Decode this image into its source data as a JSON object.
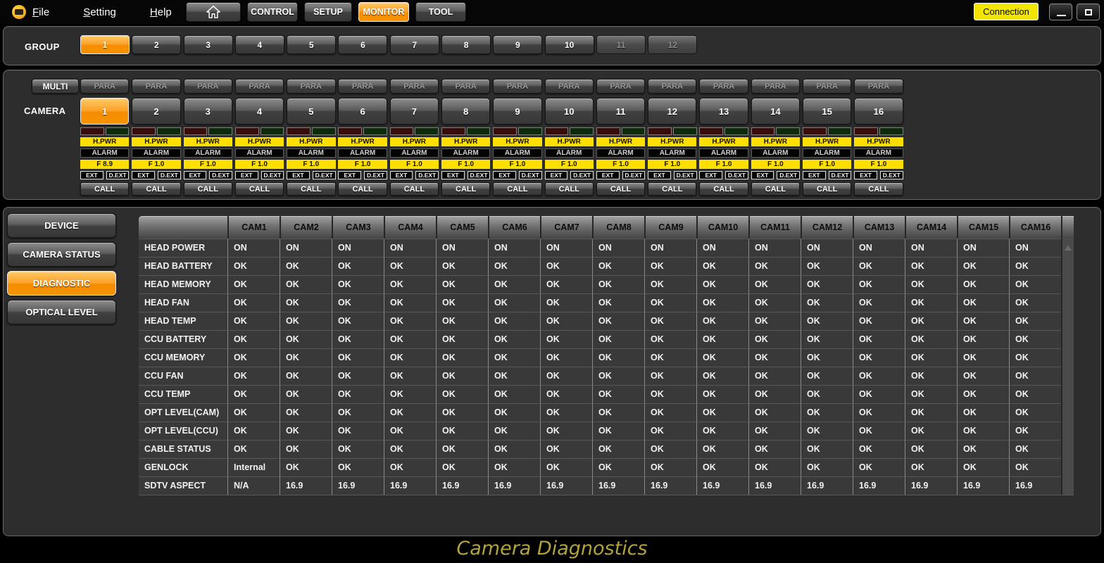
{
  "titlebar": {
    "menus": [
      {
        "label": "File"
      },
      {
        "label": "Setting"
      },
      {
        "label": "Help"
      }
    ],
    "nav_buttons": [
      {
        "label": "CONTROL",
        "state": ""
      },
      {
        "label": "SETUP",
        "state": ""
      },
      {
        "label": "MONITOR",
        "state": "active"
      },
      {
        "label": "TOOL",
        "state": ""
      }
    ],
    "connection_label": "Connection",
    "icons": {
      "home": "⌂",
      "minimize": "_",
      "maximize": "□",
      "app_logo": "camera-logo"
    }
  },
  "group_bar": {
    "label": "GROUP",
    "buttons": [
      {
        "num": "1",
        "state": "active"
      },
      {
        "num": "2",
        "state": ""
      },
      {
        "num": "3",
        "state": ""
      },
      {
        "num": "4",
        "state": ""
      },
      {
        "num": "5",
        "state": ""
      },
      {
        "num": "6",
        "state": ""
      },
      {
        "num": "7",
        "state": ""
      },
      {
        "num": "8",
        "state": ""
      },
      {
        "num": "9",
        "state": ""
      },
      {
        "num": "10",
        "state": ""
      },
      {
        "num": "11",
        "state": "disabled"
      },
      {
        "num": "12",
        "state": "disabled"
      }
    ]
  },
  "camera_section": {
    "multi_label": "MULTI",
    "camera_label": "CAMERA",
    "para_label": "PARA",
    "hpwr_label": "H.PWR",
    "alarm_label": "ALARM",
    "ext_label": "EXT",
    "dext_label": "D.EXT",
    "call_label": "CALL",
    "para_buttons": [
      {
        "label": "PARA"
      },
      {
        "label": "PARA"
      },
      {
        "label": "PARA"
      },
      {
        "label": "PARA"
      },
      {
        "label": "PARA"
      },
      {
        "label": "PARA"
      },
      {
        "label": "PARA"
      },
      {
        "label": "PARA"
      },
      {
        "label": "PARA"
      },
      {
        "label": "PARA"
      },
      {
        "label": "PARA"
      },
      {
        "label": "PARA"
      },
      {
        "label": "PARA"
      },
      {
        "label": "PARA"
      },
      {
        "label": "PARA"
      },
      {
        "label": "PARA"
      }
    ],
    "cameras": [
      {
        "num": "1",
        "state": "active",
        "f": "F 8.9"
      },
      {
        "num": "2",
        "state": "",
        "f": "F 1.0"
      },
      {
        "num": "3",
        "state": "",
        "f": "F 1.0"
      },
      {
        "num": "4",
        "state": "",
        "f": "F 1.0"
      },
      {
        "num": "5",
        "state": "",
        "f": "F 1.0"
      },
      {
        "num": "6",
        "state": "",
        "f": "F 1.0"
      },
      {
        "num": "7",
        "state": "",
        "f": "F 1.0"
      },
      {
        "num": "8",
        "state": "",
        "f": "F 1.0"
      },
      {
        "num": "9",
        "state": "",
        "f": "F 1.0"
      },
      {
        "num": "10",
        "state": "",
        "f": "F 1.0"
      },
      {
        "num": "11",
        "state": "",
        "f": "F 1.0"
      },
      {
        "num": "12",
        "state": "",
        "f": "F 1.0"
      },
      {
        "num": "13",
        "state": "",
        "f": "F 1.0"
      },
      {
        "num": "14",
        "state": "",
        "f": "F 1.0"
      },
      {
        "num": "15",
        "state": "",
        "f": "F 1.0"
      },
      {
        "num": "16",
        "state": "",
        "f": "F 1.0"
      }
    ]
  },
  "sidebar": {
    "items": [
      {
        "label": "DEVICE",
        "state": ""
      },
      {
        "label": "CAMERA STATUS",
        "state": ""
      },
      {
        "label": "DIAGNOSTIC",
        "state": "active"
      },
      {
        "label": "OPTICAL LEVEL",
        "state": ""
      }
    ]
  },
  "table": {
    "columns": [
      "CAM1",
      "CAM2",
      "CAM3",
      "CAM4",
      "CAM5",
      "CAM6",
      "CAM7",
      "CAM8",
      "CAM9",
      "CAM10",
      "CAM11",
      "CAM12",
      "CAM13",
      "CAM14",
      "CAM15",
      "CAM16"
    ],
    "rows": [
      {
        "label": "HEAD POWER",
        "values": [
          "ON",
          "ON",
          "ON",
          "ON",
          "ON",
          "ON",
          "ON",
          "ON",
          "ON",
          "ON",
          "ON",
          "ON",
          "ON",
          "ON",
          "ON",
          "ON"
        ]
      },
      {
        "label": "HEAD BATTERY",
        "values": [
          "OK",
          "OK",
          "OK",
          "OK",
          "OK",
          "OK",
          "OK",
          "OK",
          "OK",
          "OK",
          "OK",
          "OK",
          "OK",
          "OK",
          "OK",
          "OK"
        ]
      },
      {
        "label": "HEAD MEMORY",
        "values": [
          "OK",
          "OK",
          "OK",
          "OK",
          "OK",
          "OK",
          "OK",
          "OK",
          "OK",
          "OK",
          "OK",
          "OK",
          "OK",
          "OK",
          "OK",
          "OK"
        ]
      },
      {
        "label": "HEAD FAN",
        "values": [
          "OK",
          "OK",
          "OK",
          "OK",
          "OK",
          "OK",
          "OK",
          "OK",
          "OK",
          "OK",
          "OK",
          "OK",
          "OK",
          "OK",
          "OK",
          "OK"
        ]
      },
      {
        "label": "HEAD TEMP",
        "values": [
          "OK",
          "OK",
          "OK",
          "OK",
          "OK",
          "OK",
          "OK",
          "OK",
          "OK",
          "OK",
          "OK",
          "OK",
          "OK",
          "OK",
          "OK",
          "OK"
        ]
      },
      {
        "label": "CCU BATTERY",
        "values": [
          "OK",
          "OK",
          "OK",
          "OK",
          "OK",
          "OK",
          "OK",
          "OK",
          "OK",
          "OK",
          "OK",
          "OK",
          "OK",
          "OK",
          "OK",
          "OK"
        ]
      },
      {
        "label": "CCU MEMORY",
        "values": [
          "OK",
          "OK",
          "OK",
          "OK",
          "OK",
          "OK",
          "OK",
          "OK",
          "OK",
          "OK",
          "OK",
          "OK",
          "OK",
          "OK",
          "OK",
          "OK"
        ]
      },
      {
        "label": "CCU FAN",
        "values": [
          "OK",
          "OK",
          "OK",
          "OK",
          "OK",
          "OK",
          "OK",
          "OK",
          "OK",
          "OK",
          "OK",
          "OK",
          "OK",
          "OK",
          "OK",
          "OK"
        ]
      },
      {
        "label": "CCU TEMP",
        "values": [
          "OK",
          "OK",
          "OK",
          "OK",
          "OK",
          "OK",
          "OK",
          "OK",
          "OK",
          "OK",
          "OK",
          "OK",
          "OK",
          "OK",
          "OK",
          "OK"
        ]
      },
      {
        "label": "OPT LEVEL(CAM)",
        "values": [
          "OK",
          "OK",
          "OK",
          "OK",
          "OK",
          "OK",
          "OK",
          "OK",
          "OK",
          "OK",
          "OK",
          "OK",
          "OK",
          "OK",
          "OK",
          "OK"
        ]
      },
      {
        "label": "OPT LEVEL(CCU)",
        "values": [
          "OK",
          "OK",
          "OK",
          "OK",
          "OK",
          "OK",
          "OK",
          "OK",
          "OK",
          "OK",
          "OK",
          "OK",
          "OK",
          "OK",
          "OK",
          "OK"
        ]
      },
      {
        "label": "CABLE STATUS",
        "values": [
          "OK",
          "OK",
          "OK",
          "OK",
          "OK",
          "OK",
          "OK",
          "OK",
          "OK",
          "OK",
          "OK",
          "OK",
          "OK",
          "OK",
          "OK",
          "OK"
        ]
      },
      {
        "label": "GENLOCK",
        "values": [
          "Internal",
          "OK",
          "OK",
          "OK",
          "OK",
          "OK",
          "OK",
          "OK",
          "OK",
          "OK",
          "OK",
          "OK",
          "OK",
          "OK",
          "OK",
          "OK"
        ]
      },
      {
        "label": "SDTV ASPECT",
        "values": [
          "N/A",
          "16.9",
          "16.9",
          "16.9",
          "16.9",
          "16.9",
          "16.9",
          "16.9",
          "16.9",
          "16.9",
          "16.9",
          "16.9",
          "16.9",
          "16.9",
          "16.9",
          "16.9"
        ]
      }
    ]
  },
  "footer": {
    "title": "Camera Diagnostics"
  },
  "colors": {
    "accent_orange": "#f7941e",
    "indicator_yellow": "#ffdf00",
    "connection_yellow": "#f2e600",
    "title_gold": "#b3a23d",
    "led_red": "#3a0d0d",
    "led_green": "#0d2a0d"
  }
}
